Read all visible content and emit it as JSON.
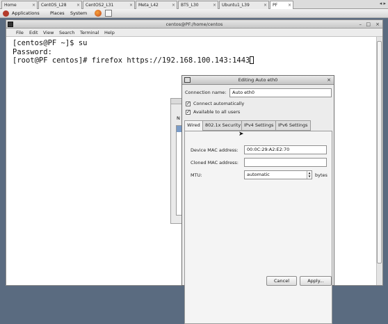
{
  "vm_tabs": [
    "Home",
    "CentOS_L28",
    "CentOS2_L31",
    "Meta_L42",
    "BT5_L30",
    "Ubuntu1_L39",
    "PF"
  ],
  "gnome_panel": {
    "applications": "Applications",
    "places": "Places",
    "system": "System"
  },
  "terminal": {
    "title": "centos@PF:/home/centos",
    "menu": [
      "File",
      "Edit",
      "View",
      "Search",
      "Terminal",
      "Help"
    ],
    "lines": [
      "[centos@PF ~]$ su",
      "Password:",
      "[root@PF centos]# firefox https://192.168.100.143:1443"
    ]
  },
  "dialog": {
    "title": "Editing Auto eth0",
    "connection_name_label": "Connection name:",
    "connection_name_value": "Auto eth0",
    "connect_automatically": {
      "label": "Connect automatically",
      "checked": true
    },
    "available_to_all_users": {
      "label": "Available to all users",
      "checked": true
    },
    "tabs": [
      "Wired",
      "802.1x Security",
      "IPv4 Settings",
      "IPv6 Settings"
    ],
    "active_tab": "Wired",
    "device_mac_label": "Device MAC address:",
    "device_mac_value": "00:0C:29:A2:E2:70",
    "cloned_mac_label": "Cloned MAC address:",
    "cloned_mac_value": "",
    "mtu_label": "MTU:",
    "mtu_value": "automatic",
    "mtu_unit": "bytes",
    "cancel_label": "Cancel",
    "apply_label": "Apply..."
  },
  "background_window_partial": "N",
  "colors": {
    "desktop": "#5a6b80",
    "terminal_bg": "#ffffff",
    "dialog_bg": "#ececec"
  }
}
